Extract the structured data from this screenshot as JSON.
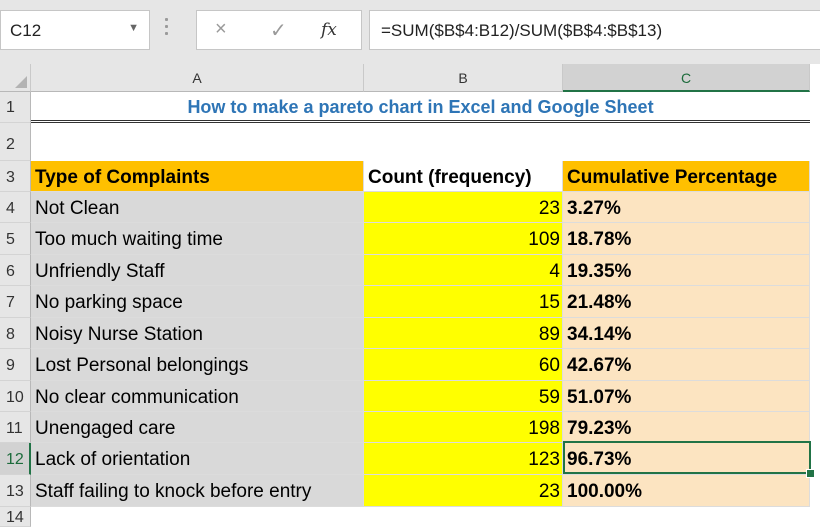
{
  "formula_bar": {
    "name_box": "C12",
    "name_box_arrow": "▼",
    "cancel_icon": "×",
    "enter_icon": "✓",
    "fx_icon": "fx",
    "formula": "=SUM($B$4:B12)/SUM($B$4:$B$13)"
  },
  "columns": [
    "A",
    "B",
    "C"
  ],
  "rows": [
    "1",
    "2",
    "3",
    "4",
    "5",
    "6",
    "7",
    "8",
    "9",
    "10",
    "11",
    "12",
    "13",
    "14"
  ],
  "sheet": {
    "title": "How to make a pareto chart in Excel and Google Sheet",
    "headers": {
      "a": "Type of Complaints",
      "b": "Count (frequency)",
      "c": "Cumulative Percentage"
    },
    "data": [
      {
        "type": "Not Clean",
        "count": "23",
        "cum": "3.27%"
      },
      {
        "type": "Too much waiting time",
        "count": "109",
        "cum": "18.78%"
      },
      {
        "type": "Unfriendly Staff",
        "count": "4",
        "cum": "19.35%"
      },
      {
        "type": "No parking space",
        "count": "15",
        "cum": "21.48%"
      },
      {
        "type": "Noisy Nurse Station",
        "count": "89",
        "cum": "34.14%"
      },
      {
        "type": "Lost Personal belongings",
        "count": "60",
        "cum": "42.67%"
      },
      {
        "type": "No clear communication",
        "count": "59",
        "cum": "51.07%"
      },
      {
        "type": "Unengaged care",
        "count": "198",
        "cum": "79.23%"
      },
      {
        "type": "Lack of orientation",
        "count": "123",
        "cum": "96.73%"
      },
      {
        "type": "Staff failing to knock before entry",
        "count": "23",
        "cum": "100.00%"
      }
    ]
  },
  "selected_cell": "C12",
  "colors": {
    "header_fill": "#ffc000",
    "count_fill": "#ffff00",
    "cumulative_fill": "#fce4c1",
    "type_fill": "#d9d9d9",
    "title_text": "#2e75b6",
    "selection": "#217346"
  }
}
